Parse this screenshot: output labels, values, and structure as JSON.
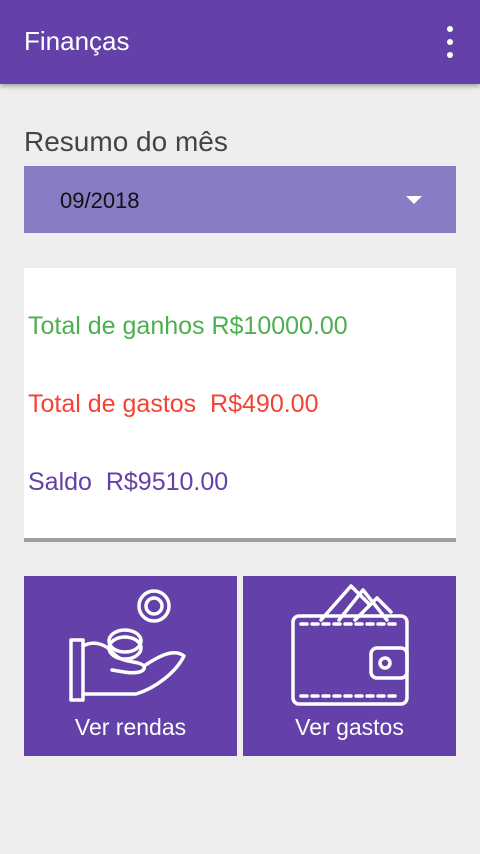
{
  "appbar": {
    "title": "Finanças",
    "menu_icon": "more-vert-icon"
  },
  "summary": {
    "heading": "Resumo do mês",
    "selected_month": "09/2018",
    "income_text": "Total de ganhos R$10000.00",
    "expense_text": "Total de gastos  R$490.00",
    "balance_text": "Saldo  R$9510.00"
  },
  "actions": {
    "income_label": "Ver rendas",
    "income_icon": "hand-coins-icon",
    "expense_label": "Ver gastos",
    "expense_icon": "wallet-icon"
  },
  "colors": {
    "primary": "#6441a9",
    "dropdown": "#8a7bc5",
    "income": "#4caf50",
    "expense": "#f44336",
    "balance": "#6441a9"
  }
}
